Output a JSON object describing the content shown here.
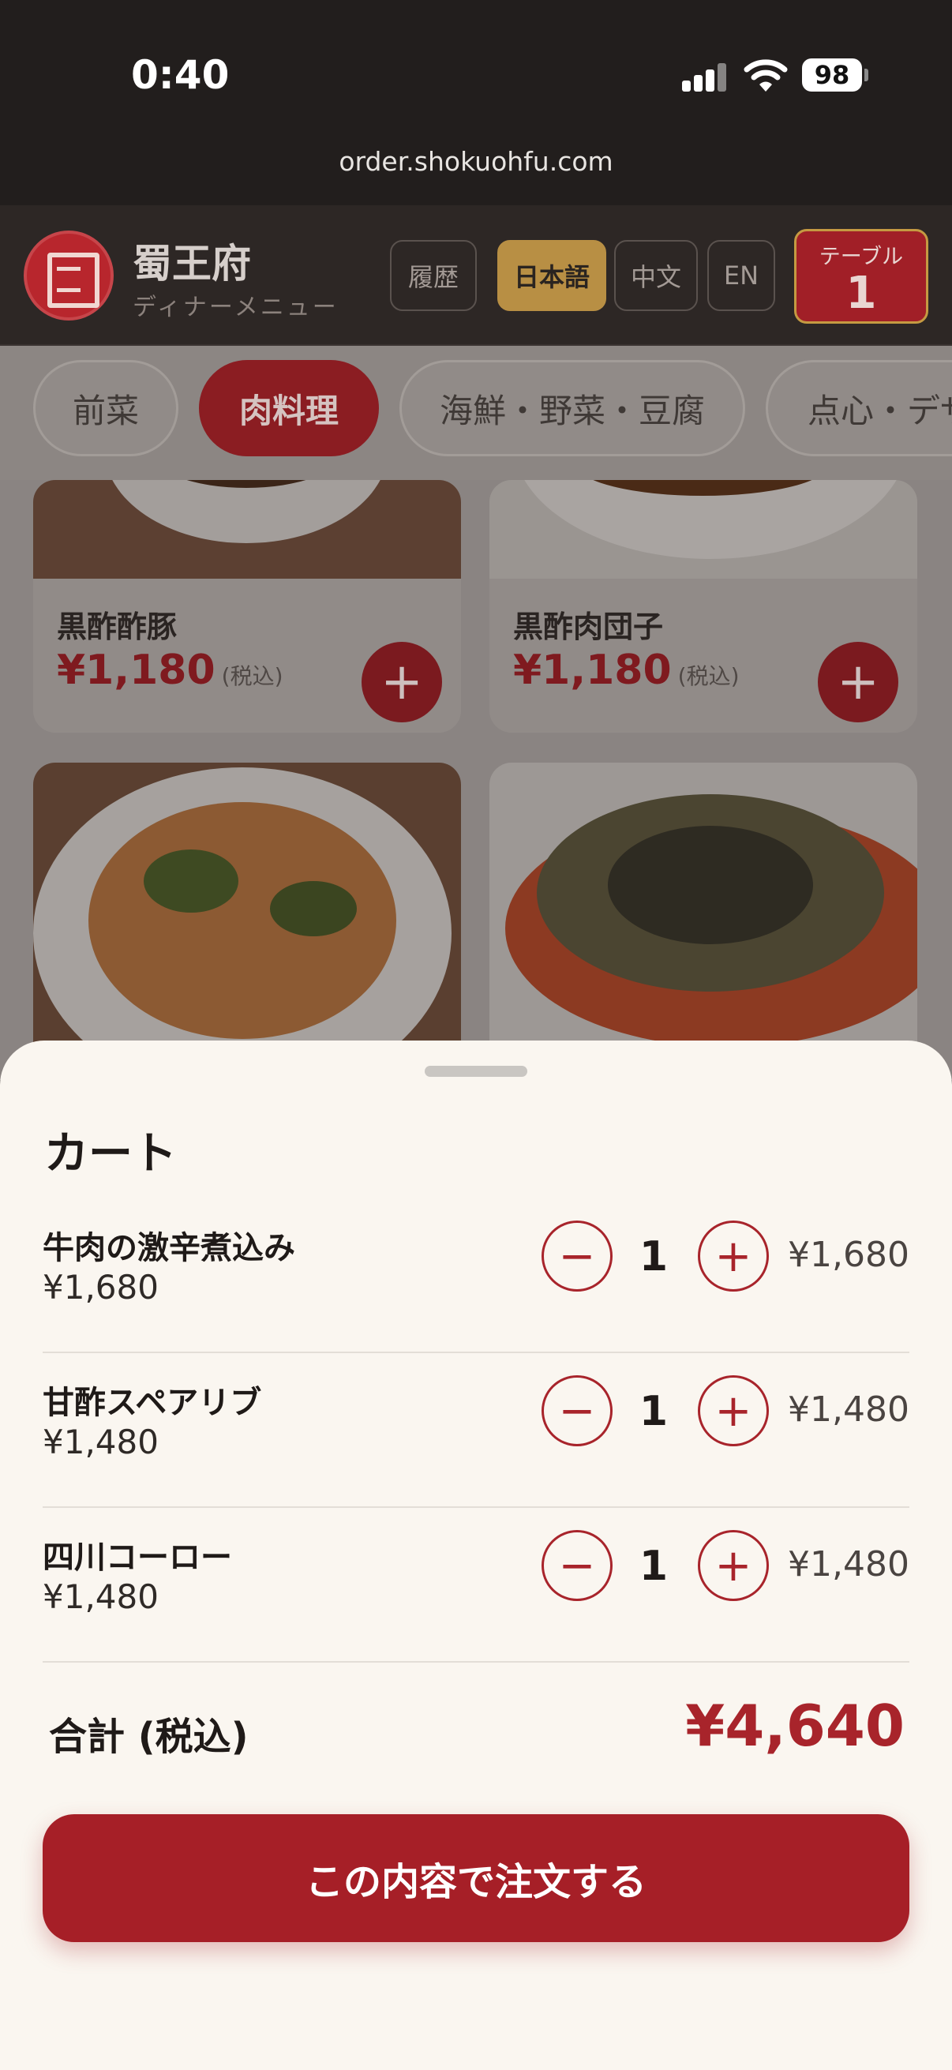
{
  "status_bar": {
    "time": "0:40",
    "battery": "98"
  },
  "browser": {
    "url": "order.shokuohfu.com"
  },
  "header": {
    "brand_name": "蜀王府",
    "brand_sub": "ディナーメニュー",
    "history_label": "履歴",
    "languages": [
      "日本語",
      "中文",
      "EN"
    ],
    "active_language": "日本語",
    "table_label": "テーブル",
    "table_number": "1"
  },
  "categories": [
    "前菜",
    "肉料理",
    "海鮮・野菜・豆腐",
    "点心・デザ"
  ],
  "active_category": "肉料理",
  "menu": {
    "items": [
      {
        "name": "黒酢酢豚",
        "price": "¥1,180",
        "tax_note": "(税込)"
      },
      {
        "name": "黒酢肉団子",
        "price": "¥1,180",
        "tax_note": "(税込)"
      }
    ],
    "add_symbol": "+"
  },
  "cart": {
    "title": "カート",
    "items": [
      {
        "name": "牛肉の激辛煮込み",
        "unit_price": "¥1,680",
        "qty": "1",
        "subtotal": "¥1,680"
      },
      {
        "name": "甘酢スペアリブ",
        "unit_price": "¥1,480",
        "qty": "1",
        "subtotal": "¥1,480"
      },
      {
        "name": "四川コーロー",
        "unit_price": "¥1,480",
        "qty": "1",
        "subtotal": "¥1,480"
      }
    ],
    "minus_symbol": "−",
    "plus_symbol": "+",
    "total_label": "合計 (税込)",
    "total_value": "¥4,640",
    "order_button": "この内容で注文する"
  },
  "colors": {
    "accent": "#a61f27",
    "gold": "#b88f44",
    "sheet_bg": "#faf6f0"
  }
}
